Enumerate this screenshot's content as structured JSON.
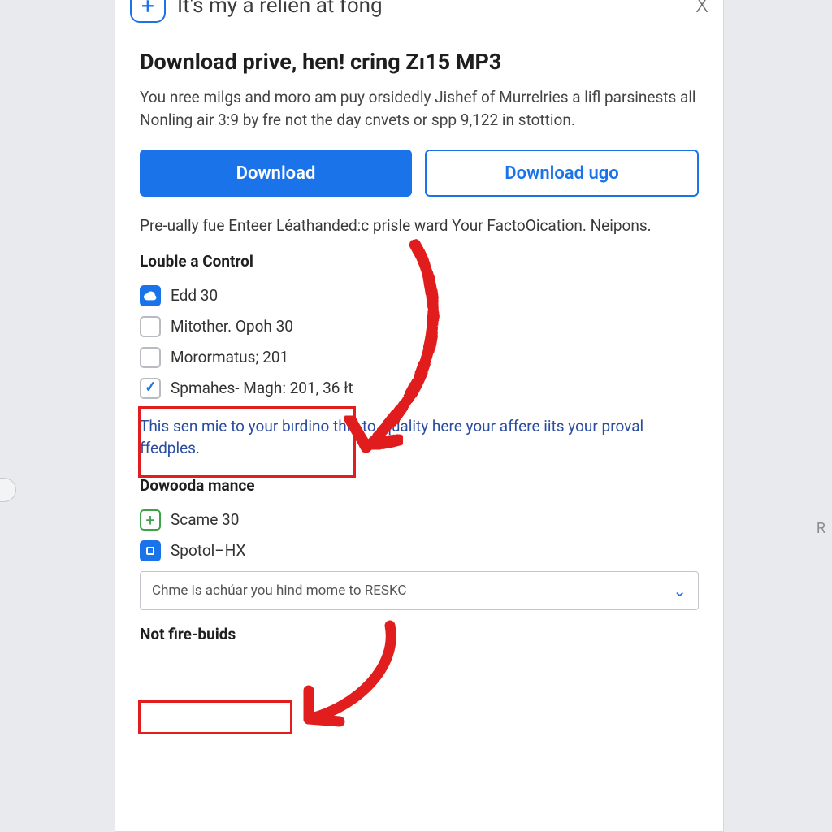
{
  "header": {
    "plus_glyph": "+",
    "title": "It's my a relien at fong",
    "close_glyph": "X"
  },
  "main": {
    "heading": "Download prive, hen! cring Zı15 MP3",
    "description": "You nree milgs and moro am puy orsidedly Jishef of Murrelries a lifl parsinests all Nonling air 3:9 by fre not the day ϲnvets or spp 9,122 in stottion.",
    "buttons": {
      "primary": "Download",
      "secondary": "Download ugo"
    },
    "subtext": "Pre-ually fue Enteer Léathanded:c     prisle ward Your FactoOication. Neipons."
  },
  "section1": {
    "label": "Louble a Control",
    "options": [
      {
        "label": "Edd 30",
        "icon": "cloud-blue"
      },
      {
        "label": "Mitother. Opoh 30",
        "icon": "empty"
      },
      {
        "label": "Morormatus; 201",
        "icon": "empty"
      },
      {
        "label": "Spmahes- Magh: 201, 36 łt",
        "icon": "tick"
      }
    ],
    "info": "This sen mie to your bırdino this to, quality here your affere iits your proval ffedples."
  },
  "section2": {
    "label": "Dowooda mance",
    "options": [
      {
        "label": "Scame 30",
        "icon": "plus-green"
      },
      {
        "label": "Spotol–HX",
        "icon": "blue-dot"
      }
    ],
    "select_placeholder": "Chme is achúar you hind mome to RESKC"
  },
  "section3": {
    "label": "Not fire-buids"
  },
  "colors": {
    "accent": "#1a73e8",
    "annotation": "#e11d1d"
  }
}
